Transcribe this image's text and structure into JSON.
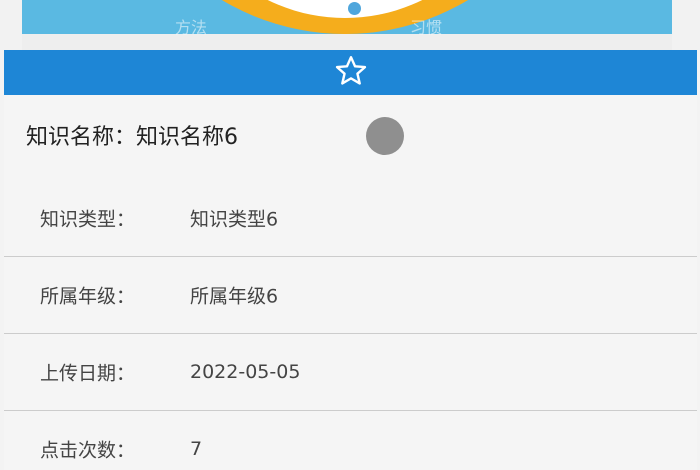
{
  "banner": {
    "left_text": "方法",
    "right_text": "习惯"
  },
  "favorite": {
    "icon": "star-outline-icon",
    "color": "#1e86d6"
  },
  "knowledge": {
    "name_label": "知识名称：",
    "name_value": "知识名称6",
    "fields": [
      {
        "label": "知识类型：",
        "value": "知识类型6"
      },
      {
        "label": "所属年级：",
        "value": "所属年级6"
      },
      {
        "label": "上传日期：",
        "value": "2022-05-05"
      },
      {
        "label": "点击次数：",
        "value": "7"
      }
    ]
  }
}
